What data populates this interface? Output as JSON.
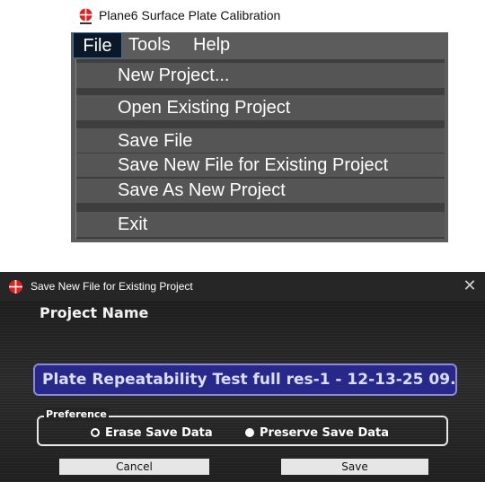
{
  "menu_window": {
    "title": "Plane6 Surface Plate Calibration",
    "menubar": [
      "File",
      "Tools",
      "Help"
    ],
    "file_menu_items": [
      "New Project...",
      "Open Existing Project",
      "Save File",
      "Save New File for Existing Project",
      "Save As New Project",
      "Exit"
    ]
  },
  "dialog": {
    "title": "Save New File for Existing Project",
    "close_glyph": "✕",
    "project_name_label": "Project Name",
    "project_name_value": "Plate Repeatability Test full res-1 - 12-13-25 09.",
    "preference_legend": "Preference",
    "option_erase": "Erase Save Data",
    "option_preserve": "Preserve Save Data",
    "selected_option": "Preserve Save Data",
    "cancel_label": "Cancel",
    "save_label": "Save"
  },
  "icons": {
    "app_logo": "crosshair-globe-logo-icon",
    "close": "close-icon"
  },
  "colors": {
    "menu_background": "#5c5c5c",
    "menu_item_background": "#555555",
    "menu_item_divider": "#3e3e3e",
    "file_menu_highlight": "#0b1829",
    "dialog_background": "#181818",
    "input_background": "#27288a",
    "input_border": "#8a8ad8",
    "logo_red": "#e02020"
  }
}
